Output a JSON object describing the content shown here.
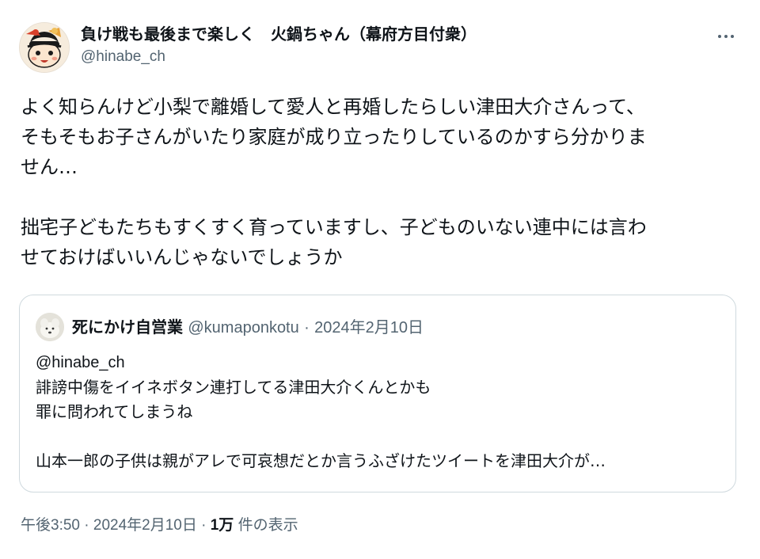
{
  "author": {
    "display_name": "負け戦も最後まで楽しく　火鍋ちゃん（幕府方目付衆）",
    "handle": "@hinabe_ch",
    "avatar_icon": "cartoon-face-avatar",
    "more_icon": "more-options-icon"
  },
  "tweet": {
    "paragraphs": [
      "よく知らんけど小梨で離婚して愛人と再婚したらしい津田大介さんって、\nそもそもお子さんがいたり家庭が成り立ったりしているのかすら分かりま\nせん…",
      "拙宅子どもたちもすくすく育っていますし、子どものいない連中には言わ\nせておけばいいんじゃないでしょうか"
    ]
  },
  "quote": {
    "display_name": "死にかけ自営業",
    "handle": "@kumaponkotu",
    "separator": "·",
    "date": "2024年2月10日",
    "avatar_icon": "dog-avatar",
    "lines": [
      "@hinabe_ch",
      "誹謗中傷をイイネボタン連打してる津田大介くんとかも",
      "罪に問われてしまうね",
      "",
      "山本一郎の子供は親がアレで可哀想だとか言うふざけたツイートを津田大介が…"
    ]
  },
  "footer": {
    "time": "午後3:50",
    "sep1": "·",
    "date": "2024年2月10日",
    "sep2": "·",
    "views_count": "1万",
    "views_label": "件の表示"
  },
  "colors": {
    "text": "#0f1419",
    "secondary": "#536471",
    "border": "#cfd9de"
  }
}
